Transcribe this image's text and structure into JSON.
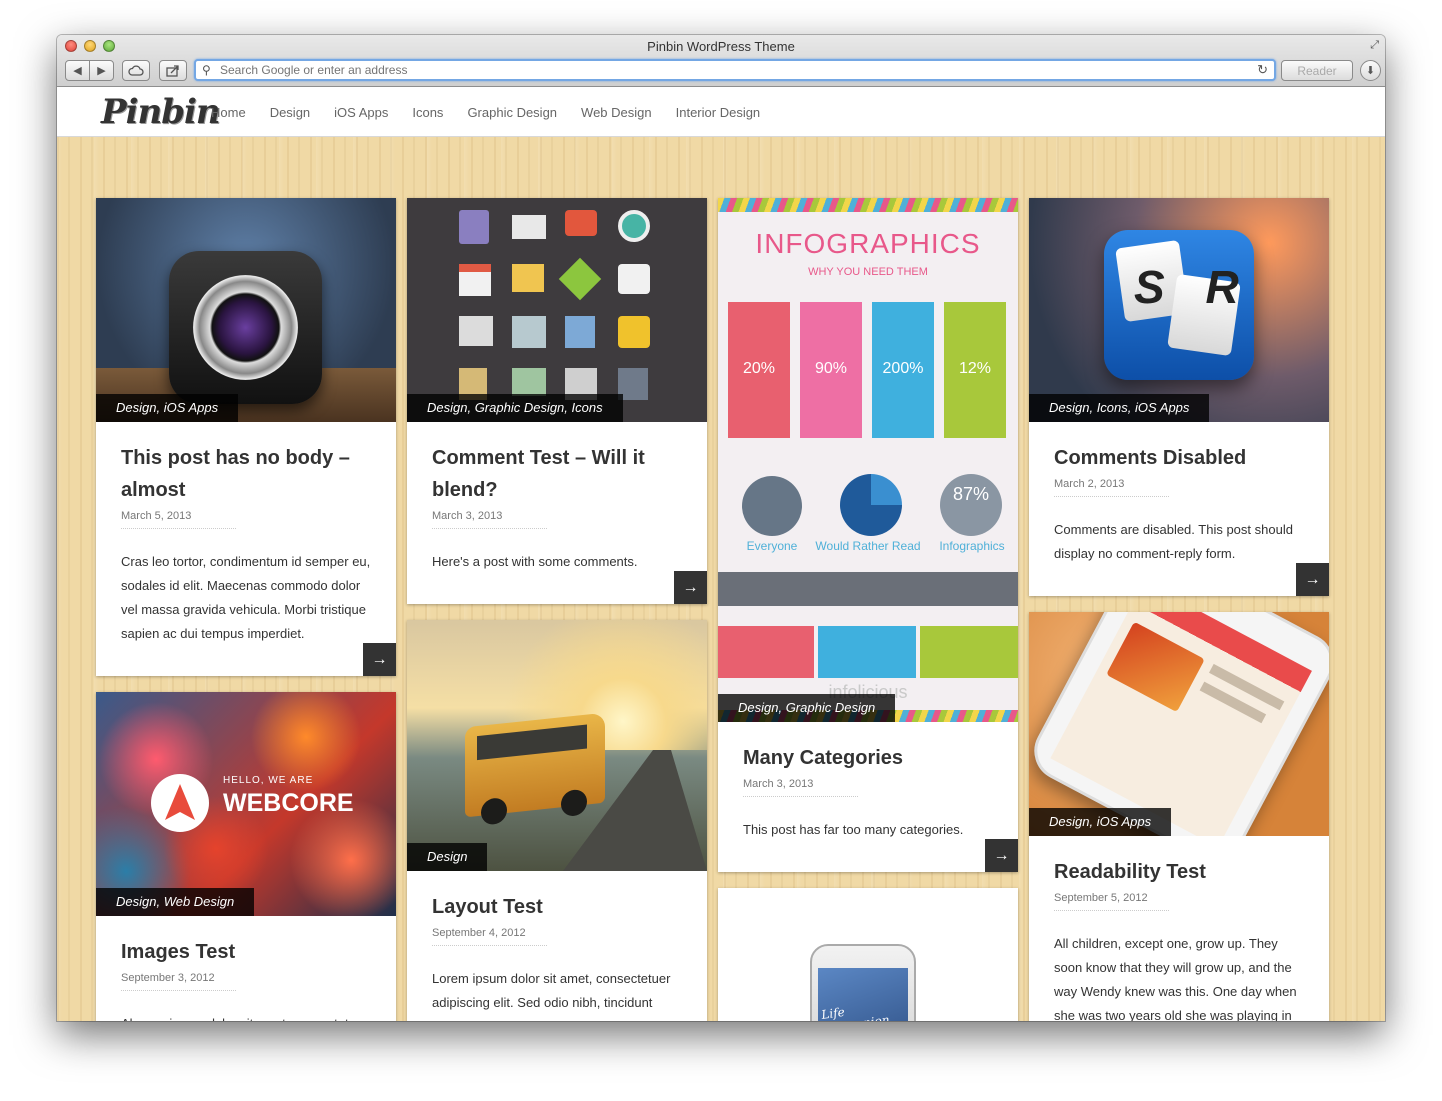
{
  "window": {
    "title": "Pinbin WordPress Theme",
    "address_placeholder": "Search Google or enter an address",
    "reader_label": "Reader"
  },
  "site": {
    "logo": "Pinbin",
    "nav": [
      "Home",
      "Design",
      "iOS Apps",
      "Icons",
      "Graphic Design",
      "Web Design",
      "Interior Design"
    ]
  },
  "infographic": {
    "title": "INFOGRAPHICS",
    "subtitle": "WHY YOU NEED THEM",
    "stats": [
      "20%",
      "90%",
      "200%",
      "12%"
    ],
    "pct": "87%",
    "labels": [
      "Everyone",
      "Would Rather Read",
      "Infographics"
    ],
    "brand": "infolicious"
  },
  "thumbs": {
    "webcore_small": "HELLO, WE ARE",
    "webcore_big": "WEBCORE",
    "phone_text": "Life companion",
    "sr_text": "S R"
  },
  "posts": [
    {
      "cats": "Design, iOS Apps",
      "title": "This post has no body – almost",
      "date": "March 5, 2013",
      "text": "Cras leo tortor, condimentum id semper eu, sodales id elit. Maecenas commodo dolor vel massa gravida vehicula. Morbi tristique sapien ac dui tempus imperdiet."
    },
    {
      "cats": "Design, Web Design",
      "title": "Images Test",
      "date": "September 3, 2012",
      "text": "Al orem ipsum dolor sit amet, consectetuer"
    },
    {
      "cats": "Design, Graphic Design, Icons",
      "title": "Comment Test – Will it blend?",
      "date": "March 3, 2013",
      "text": "Here's a post with some comments."
    },
    {
      "cats": "Design",
      "title": "Layout Test",
      "date": "September 4, 2012",
      "text": "Lorem ipsum dolor sit amet, consectetuer adipiscing elit. Sed odio nibh, tincidunt adipiscing, pretium nec, tincidunt id, enim."
    },
    {
      "cats": "Design, Graphic Design",
      "title": "Many Categories",
      "date": "March 3, 2013",
      "text": "This post has far too many categories."
    },
    {
      "cats": "Design, Icons, iOS Apps",
      "title": "Comments Disabled",
      "date": "March 2, 2013",
      "text": "Comments are disabled. This post should display no comment-reply form."
    },
    {
      "cats": "Design, iOS Apps",
      "title": "Readability Test",
      "date": "September 5, 2012",
      "text": "All children, except one, grow up. They soon know that they will grow up, and the way Wendy knew was this. One day when she was two years old she was playing in"
    }
  ],
  "more_arrow": "→",
  "colors": {
    "wood": "#f0d9a5",
    "dark_label": "#333333"
  }
}
